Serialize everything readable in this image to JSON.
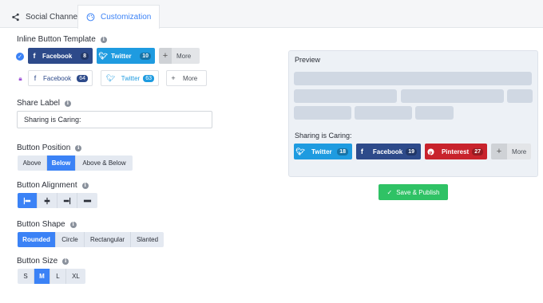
{
  "tabs": [
    {
      "label": "Social Channels",
      "icon": "share-icon"
    },
    {
      "label": "Customization",
      "icon": "palette-icon"
    }
  ],
  "template": {
    "label": "Inline Button Template",
    "row1": {
      "facebook": {
        "name": "Facebook",
        "count": "8"
      },
      "twitter": {
        "name": "Twitter",
        "count": "10"
      },
      "more": "More"
    },
    "row2": {
      "facebook": {
        "name": "Facebook",
        "count": "64"
      },
      "twitter": {
        "name": "Twitter",
        "count": "63"
      },
      "more": "More"
    }
  },
  "share_label": {
    "label": "Share Label",
    "value": "Sharing is Caring:"
  },
  "position": {
    "label": "Button Position",
    "options": [
      "Above",
      "Below",
      "Above & Below"
    ],
    "selected": "Below"
  },
  "alignment": {
    "label": "Button Alignment",
    "options": [
      "align-left-icon",
      "align-center-icon",
      "align-right-icon",
      "align-stretch-icon"
    ],
    "selected": "align-left-icon"
  },
  "shape": {
    "label": "Button Shape",
    "options": [
      "Rounded",
      "Circle",
      "Rectangular",
      "Slanted"
    ],
    "selected": "Rounded"
  },
  "size": {
    "label": "Button Size",
    "options": [
      "S",
      "M",
      "L",
      "XL"
    ],
    "selected": "M"
  },
  "preview": {
    "title": "Preview",
    "share_text": "Sharing is Caring:",
    "buttons": {
      "twitter": {
        "name": "Twitter",
        "count": "18"
      },
      "facebook": {
        "name": "Facebook",
        "count": "19"
      },
      "pinterest": {
        "name": "Pinterest",
        "count": "27"
      },
      "more": "More"
    }
  },
  "publish_label": "Save & Publish",
  "colors": {
    "accent": "#3b82f6",
    "facebook": "#2d4a8a",
    "twitter": "#1e9be0",
    "pinterest": "#c8232c",
    "publish": "#2fc265"
  }
}
